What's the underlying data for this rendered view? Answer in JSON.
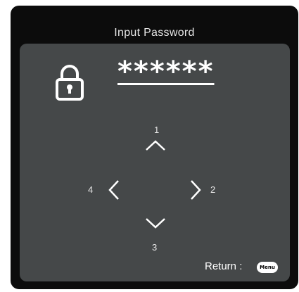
{
  "dialog": {
    "title": "Input Password",
    "password_mask": "******",
    "icons": {
      "lock": "lock-icon",
      "up": "chevron-up-icon",
      "right": "chevron-right-icon",
      "down": "chevron-down-icon",
      "left": "chevron-left-icon"
    },
    "directions": {
      "up": "1",
      "right": "2",
      "down": "3",
      "left": "4"
    },
    "return_label": "Return :",
    "menu_button_label": "Menu"
  }
}
